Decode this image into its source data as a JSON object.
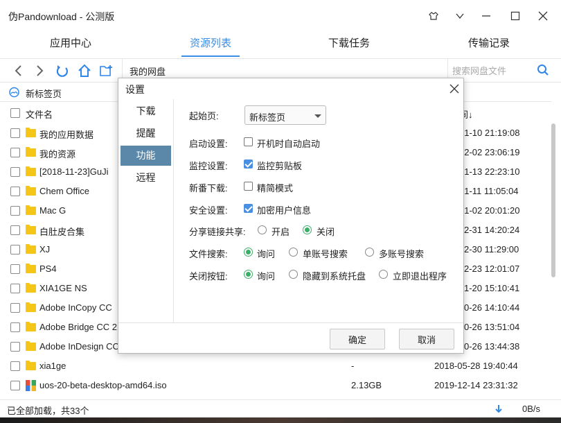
{
  "window": {
    "title": "伪Pandownload - 公测版"
  },
  "tabs": [
    {
      "label": "应用中心"
    },
    {
      "label": "资源列表"
    },
    {
      "label": "下载任务"
    },
    {
      "label": "传输记录"
    }
  ],
  "toolbar": {
    "path": "我的网盘",
    "search_placeholder": "搜索网盘文件"
  },
  "breadcrumb": {
    "label": "新标签页"
  },
  "list": {
    "col_name": "文件名",
    "col_time_partial": "间↓",
    "rows": [
      {
        "name": "我的应用数据",
        "size": "",
        "time": "01-10 21:19:08"
      },
      {
        "name": "我的资源",
        "size": "",
        "time": "02-02 23:06:19"
      },
      {
        "name": "[2018-11-23]GuJi",
        "size": "",
        "time": "01-13 22:23:10"
      },
      {
        "name": "Chem Office",
        "size": "",
        "time": "01-11 11:05:04"
      },
      {
        "name": "Mac G",
        "size": "",
        "time": "01-02 20:01:20"
      },
      {
        "name": "白肚皮合集",
        "size": "",
        "time": "2-31 14:20:24"
      },
      {
        "name": "XJ",
        "size": "",
        "time": "2-30 11:29:00"
      },
      {
        "name": "PS4",
        "size": "",
        "time": "2-23 12:01:07"
      },
      {
        "name": "XIA1GE NS",
        "size": "",
        "time": "1-20 15:10:41"
      },
      {
        "name": "Adobe InCopy CC",
        "size": "",
        "time": "0-26 14:10:44"
      },
      {
        "name": "Adobe Bridge CC 2",
        "size": "",
        "time": "0-26 13:51:04"
      },
      {
        "name": "Adobe InDesign CC",
        "size": "",
        "time": "0-26 13:44:38"
      },
      {
        "name": "xia1ge",
        "size": "-",
        "time": "2018-05-28 19:40:44"
      },
      {
        "name": "uos-20-beta-desktop-amd64.iso",
        "size": "2.13GB",
        "time": "2019-12-14 23:31:32"
      }
    ]
  },
  "status": {
    "text": "已全部加载，共33个",
    "speed": "0B/s"
  },
  "dialog": {
    "title": "设置",
    "nav": [
      {
        "label": "下载"
      },
      {
        "label": "提醒"
      },
      {
        "label": "功能"
      },
      {
        "label": "远程"
      }
    ],
    "options": {
      "start_page_label": "起始页:",
      "start_page_value": "新标签页",
      "startup_label": "启动设置:",
      "startup_opt": "开机时自动启动",
      "monitor_label": "监控设置:",
      "monitor_opt": "监控剪贴板",
      "bangumi_label": "新番下载:",
      "bangumi_opt": "精简模式",
      "security_label": "安全设置:",
      "security_opt": "加密用户信息",
      "share_label": "分享链接共享:",
      "share_on": "开启",
      "share_off": "关闭",
      "search_label": "文件搜索:",
      "search_ask": "询问",
      "search_single": "单账号搜索",
      "search_multi": "多账号搜索",
      "close_label": "关闭按钮:",
      "close_ask": "询问",
      "close_tray": "隐藏到系统托盘",
      "close_exit": "立即退出程序"
    },
    "ok": "确定",
    "cancel": "取消"
  },
  "colors": {
    "accent": "#3a8ee6",
    "nav_active": "#5b87a8",
    "radio_on": "#3dae6a",
    "folder": "#f5c518"
  }
}
